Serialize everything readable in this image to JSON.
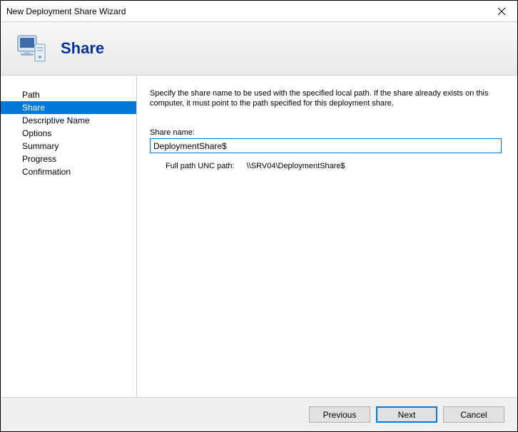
{
  "window": {
    "title": "New Deployment Share Wizard"
  },
  "header": {
    "title": "Share"
  },
  "sidebar": {
    "items": [
      {
        "label": "Path"
      },
      {
        "label": "Share"
      },
      {
        "label": "Descriptive Name"
      },
      {
        "label": "Options"
      },
      {
        "label": "Summary"
      },
      {
        "label": "Progress"
      },
      {
        "label": "Confirmation"
      }
    ],
    "selected_index": 1
  },
  "content": {
    "instructions": "Specify the share name to be used with the specified local path.  If the share already exists on this computer, it must point to the path specified for this deployment share.",
    "share_name_label": "Share name:",
    "share_name_value": "DeploymentShare$",
    "full_path_label": "Full path UNC path:",
    "full_path_value": "\\\\SRV04\\DeploymentShare$"
  },
  "buttons": {
    "previous": "Previous",
    "next": "Next",
    "cancel": "Cancel"
  }
}
